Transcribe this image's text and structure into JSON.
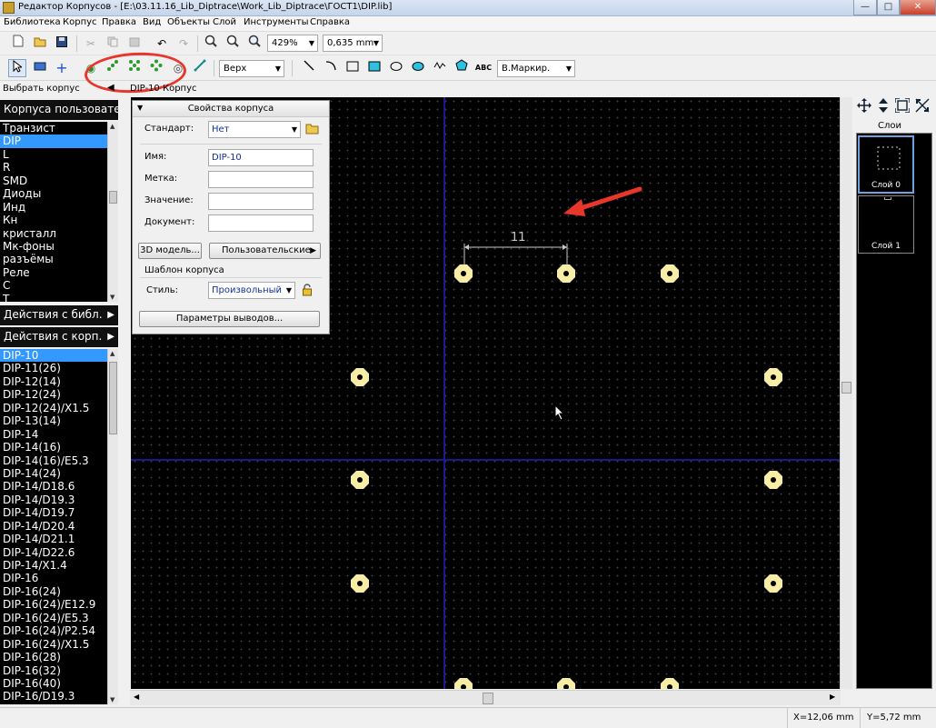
{
  "window": {
    "title": "Редактор Корпусов - [E:\\03.11.16_Lib_Diptrace\\Work_Lib_Diptrace\\ГОСТ1\\DIP.lib]",
    "min_label": "—",
    "max_label": "□",
    "close_label": "✕"
  },
  "menu": [
    "Библиотека",
    "Корпус",
    "Правка",
    "Вид",
    "Объекты",
    "Слой",
    "Инструменты",
    "Справка"
  ],
  "toolbar": {
    "zoom": "429%",
    "grid": "0,635 mm",
    "layer_side": "Верх",
    "text_style": "В.Маркир."
  },
  "left_panel": {
    "header": "Выбрать корпус",
    "collapse_icon": "◀",
    "group_header": "Корпуса пользовате...",
    "groups": [
      "Транзист",
      "DIP",
      "L",
      "R",
      "SMD",
      "Диоды",
      "Инд",
      "Кн",
      "кристалл",
      "Мк-фоны",
      "разъёмы",
      "Реле",
      "С",
      "Т"
    ],
    "selected_group": "DIP",
    "lib_actions": "Действия с библ.",
    "pkg_actions": "Действия с корп.",
    "packages": [
      "DIP-10",
      "DIP-11(26)",
      "DIP-12(14)",
      "DIP-12(24)",
      "DIP-12(24)/X1.5",
      "DIP-13(14)",
      "DIP-14",
      "DIP-14(16)",
      "DIP-14(16)/E5.3",
      "DIP-14(24)",
      "DIP-14/D18.6",
      "DIP-14/D19.3",
      "DIP-14/D19.7",
      "DIP-14/D20.4",
      "DIP-14/D21.1",
      "DIP-14/D22.6",
      "DIP-14/X1.4",
      "DIP-16",
      "DIP-16(24)",
      "DIP-16(24)/E12.9",
      "DIP-16(24)/E5.3",
      "DIP-16(24)/P2.54",
      "DIP-16(24)/X1.5",
      "DIP-16(28)",
      "DIP-16(32)",
      "DIP-16(40)",
      "DIP-16/D19.3"
    ],
    "selected_package": "DIP-10"
  },
  "canvas": {
    "tab_label": "DIP-10 Корпус",
    "dimension_value": "11"
  },
  "properties": {
    "title": "Свойства корпуса",
    "standard_label": "Стандарт:",
    "standard_value": "Нет",
    "name_label": "Имя:",
    "name_value": "DIP-10",
    "mark_label": "Метка:",
    "mark_value": "",
    "value_label": "Значение:",
    "value_value": "",
    "document_label": "Документ:",
    "document_value": "",
    "model3d_button": "3D модель...",
    "custom_button": "Пользовательские",
    "template_section": "Шаблон корпуса",
    "style_label": "Стиль:",
    "style_value": "Произвольный",
    "pins_button": "Параметры выводов..."
  },
  "right_panel": {
    "title": "Слои",
    "layers": [
      "Слой 0",
      "Слой 1"
    ]
  },
  "status": {
    "x": "X=12,06 mm",
    "y": "Y=5,72 mm"
  },
  "colors": {
    "canvas_bg": "#000000",
    "pad": "#f8eda5",
    "axis": "#1a1a8c",
    "selection": "#3399ff",
    "annotation": "#e8362b"
  }
}
